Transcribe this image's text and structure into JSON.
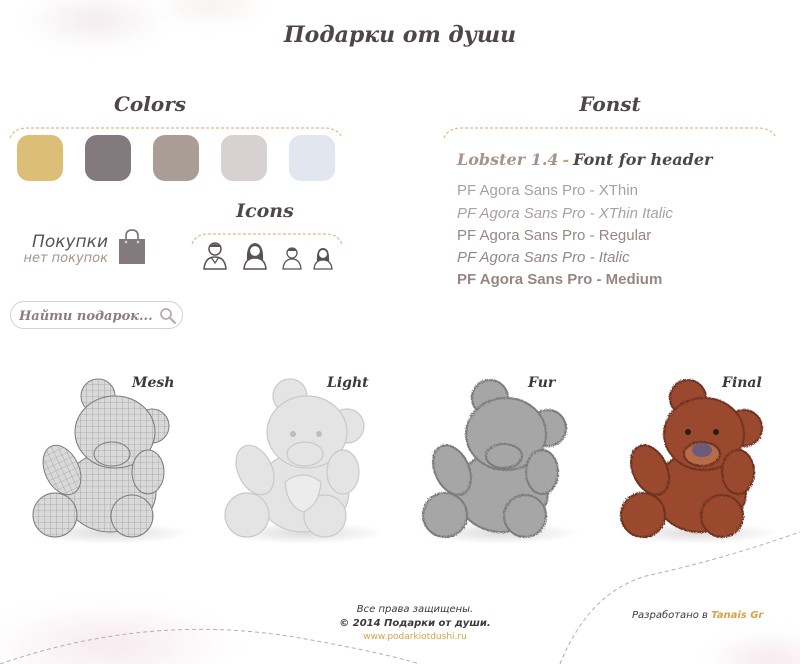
{
  "page": {
    "title": "Подарки от души"
  },
  "colors": {
    "title": "Colors",
    "swatches": [
      "#dcbe76",
      "#837a7e",
      "#aa9d95",
      "#d8d1d1",
      "#e2e6ef"
    ]
  },
  "fonts": {
    "title": "Fonst",
    "header_font": "Lobster 1.4",
    "header_separator": "-",
    "header_desc": "Font for header",
    "lines": [
      "PF Agora Sans Pro - XThin",
      "PF Agora Sans Pro - XThin Italic",
      "PF Agora Sans Pro - Regular",
      "PF Agora Sans Pro - Italic",
      "PF Agora Sans Pro - Medium"
    ]
  },
  "icons": {
    "title": "Icons",
    "items": [
      "man-icon",
      "woman-icon",
      "boy-icon",
      "girl-icon"
    ]
  },
  "cart": {
    "label": "Покупки",
    "status": "нет покупок",
    "icon": "shopping-bag-icon"
  },
  "search": {
    "placeholder": "Найти подарок...",
    "icon": "search-icon"
  },
  "bears": [
    {
      "label": "Mesh"
    },
    {
      "label": "Light"
    },
    {
      "label": "Fur"
    },
    {
      "label": "Final"
    }
  ],
  "footer": {
    "rights": "Все права защищены.",
    "copyright": "© 2014 Подарки от души.",
    "site": "www.podarkiotdushi.ru",
    "dev_prefix": "Разработано в",
    "dev_name": "Tanais Gr"
  },
  "accent_colors": {
    "gold": "#d4a24b",
    "dash": "#e0b98a",
    "text": "#4f4747"
  }
}
